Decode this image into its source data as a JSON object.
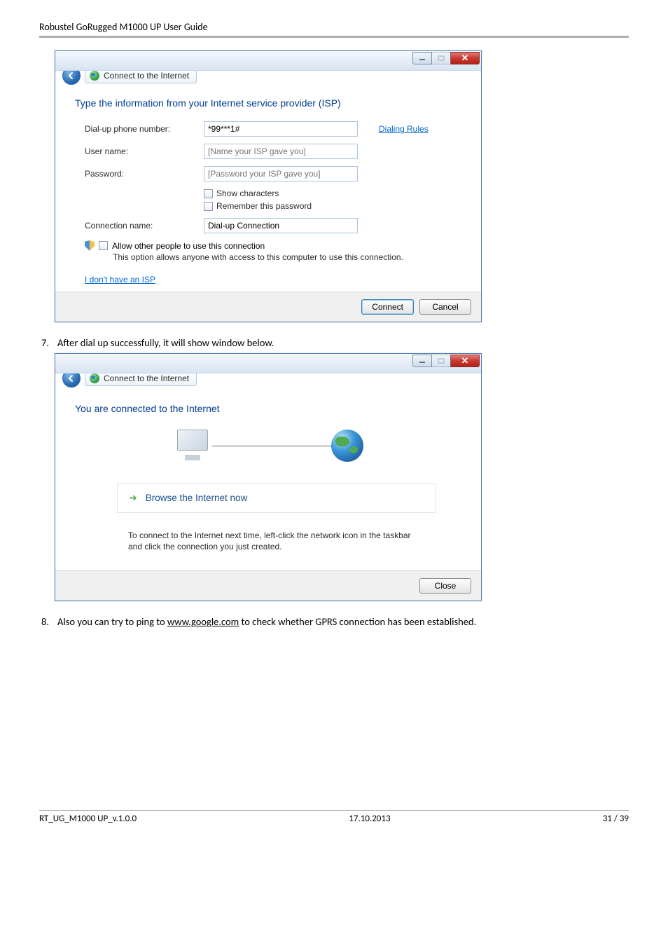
{
  "doc": {
    "header": "Robustel GoRugged M1000 UP User Guide",
    "footer_left": "RT_UG_M1000 UP_v.1.0.0",
    "footer_center": "17.10.2013",
    "footer_right": "31 / 39"
  },
  "win1": {
    "crumb": "Connect to the Internet",
    "heading": "Type the information from your Internet service provider (ISP)",
    "labels": {
      "phone": "Dial-up phone number:",
      "user": "User name:",
      "pass": "Password:",
      "conn": "Connection name:"
    },
    "values": {
      "phone": "*99***1#",
      "user_ph": "[Name your ISP gave you]",
      "pass_ph": "[Password your ISP gave you]",
      "conn": "Dial-up Connection"
    },
    "dialing_rules": "Dialing Rules",
    "show_chars": "Show characters",
    "remember": "Remember this password",
    "allow_label": "Allow other people to use this connection",
    "allow_desc": "This option allows anyone with access to this computer to use this connection.",
    "no_isp": "I don't have an ISP",
    "btn_connect": "Connect",
    "btn_cancel": "Cancel"
  },
  "step7": {
    "num": "7.",
    "text": "After dial up successfully, it will show window below."
  },
  "win2": {
    "crumb": "Connect to the Internet",
    "heading": "You are connected to the Internet",
    "browse": "Browse the Internet now",
    "hint": "To connect to the Internet next time, left-click the network icon in the taskbar and click the connection you just created.",
    "btn_close": "Close"
  },
  "step8": {
    "num": "8.",
    "pre": "Also you can try to ping to ",
    "link": "www.google.com",
    "post": " to check whether GPRS connection has been established."
  }
}
